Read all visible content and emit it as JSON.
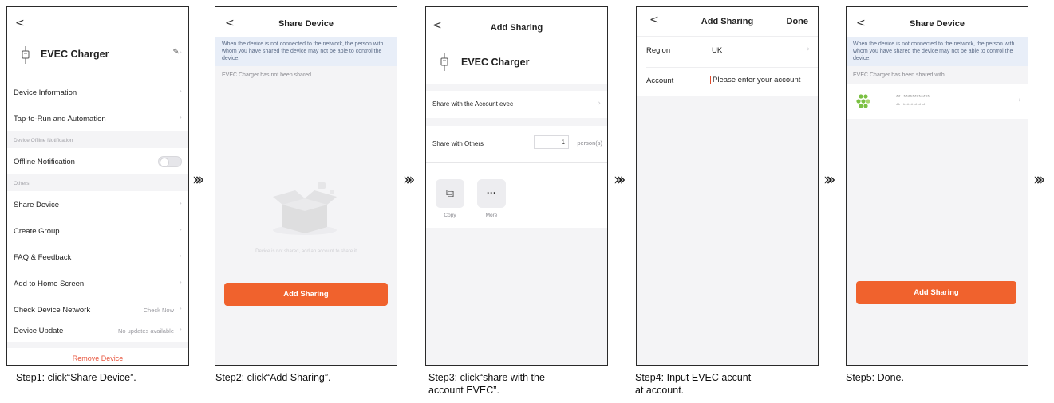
{
  "screen1": {
    "back": "<",
    "device_name": "EVEC Charger",
    "edit_icon": "pencil-icon",
    "items_top": [
      {
        "label": "Device Information"
      },
      {
        "label": "Tap-to-Run and Automation"
      }
    ],
    "section_offline": "Device Offline Notification",
    "offline_label": "Offline Notification",
    "section_others": "Others",
    "items_others": [
      {
        "label": "Share Device"
      },
      {
        "label": "Create Group"
      },
      {
        "label": "FAQ & Feedback"
      },
      {
        "label": "Add to Home Screen"
      }
    ],
    "check_network": {
      "label": "Check Device Network",
      "value": "Check Now"
    },
    "device_update": {
      "label": "Device Update",
      "value": "No updates available"
    },
    "remove": "Remove Device"
  },
  "screen2": {
    "back": "<",
    "title": "Share Device",
    "note": "When the device is not connected to the network, the person with whom you have shared the device may not be able to control the device.",
    "status": "EVEC Charger has not been shared",
    "empty_text": "Device is not shared, add an account to share it",
    "button": "Add Sharing"
  },
  "screen3": {
    "back": "<",
    "title": "Add Sharing",
    "device_name": "EVEC Charger",
    "share_account": "Share with the Account evec",
    "share_others": "Share with Others",
    "persons_value": "1",
    "persons_unit": "person(s)",
    "actions": [
      {
        "label": "Copy",
        "icon": "copy-icon",
        "glyph": "⧉"
      },
      {
        "label": "More",
        "icon": "more-icon",
        "glyph": "···"
      }
    ]
  },
  "screen4": {
    "back": "<",
    "title": "Add Sharing",
    "done": "Done",
    "region_label": "Region",
    "region_value": "UK",
    "account_label": "Account",
    "account_placeholder": "Please enter your account"
  },
  "screen5": {
    "back": "<",
    "title": "Share Device",
    "note": "When the device is not connected to the network, the person with whom you have shared the device may not be able to control the device.",
    "status": "EVEC Charger has been shared with",
    "user_line1": "**_************",
    "user_line2": "**_***********",
    "button": "Add Sharing"
  },
  "captions": {
    "step1": "Step1: click“Share Device”.",
    "step2": "Step2: click“Add Sharing”.",
    "step3_line1": "Step3: click“share with the",
    "step3_line2": "account EVEC”.",
    "step4_line1": "Step4: Input EVEC accunt",
    "step4_line2": "at account.",
    "step5": "Step5: Done."
  },
  "arrow_glyph": "»»",
  "colors": {
    "accent": "#f0622d",
    "note_bg": "#e8eef8",
    "remove": "#e8553d"
  }
}
